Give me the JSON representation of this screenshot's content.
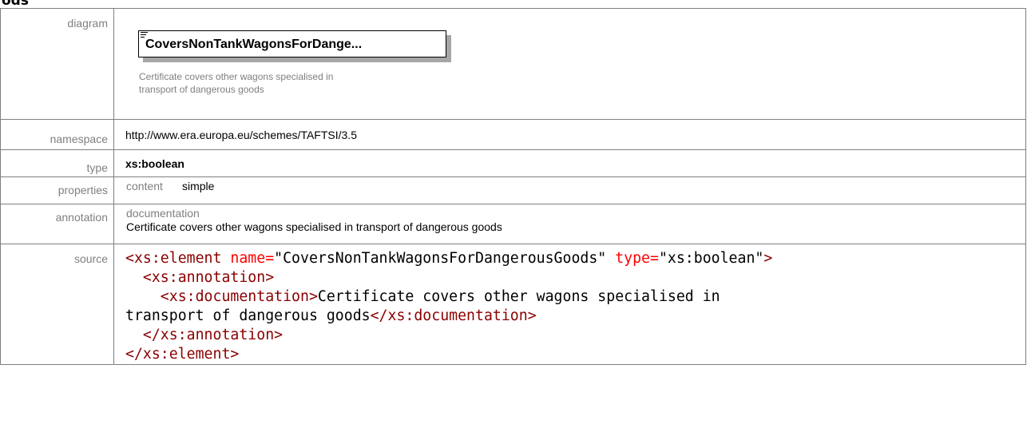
{
  "heading": "ods",
  "rows": {
    "diagram": {
      "label": "diagram",
      "element_name": "CoversNonTankWagonsForDange...",
      "element_doc": "Certificate covers other wagons specialised in transport of dangerous goods"
    },
    "namespace": {
      "label": "namespace",
      "value": "http://www.era.europa.eu/schemes/TAFTSI/3.5"
    },
    "type": {
      "label": "type",
      "value": "xs:boolean"
    },
    "properties": {
      "label": "properties",
      "key": "content",
      "value": "simple"
    },
    "annotation": {
      "label": "annotation",
      "key": "documentation",
      "value": "Certificate covers other wagons specialised in transport of dangerous goods"
    },
    "source": {
      "label": "source",
      "line1_open": "<xs:element ",
      "line1_attr1": "name=",
      "line1_val1": "\"CoversNonTankWagonsForDangerousGoods\"",
      "line1_attr2": " type=",
      "line1_val2": "\"xs:boolean\"",
      "line1_close": ">",
      "line2": "  <xs:annotation>",
      "line3_open": "    <xs:documentation>",
      "line3_text": "Certificate covers other wagons specialised in",
      "line4_text": "transport of dangerous goods",
      "line4_close": "</xs:documentation>",
      "line5": "  </xs:annotation>",
      "line6": "</xs:element>"
    }
  }
}
